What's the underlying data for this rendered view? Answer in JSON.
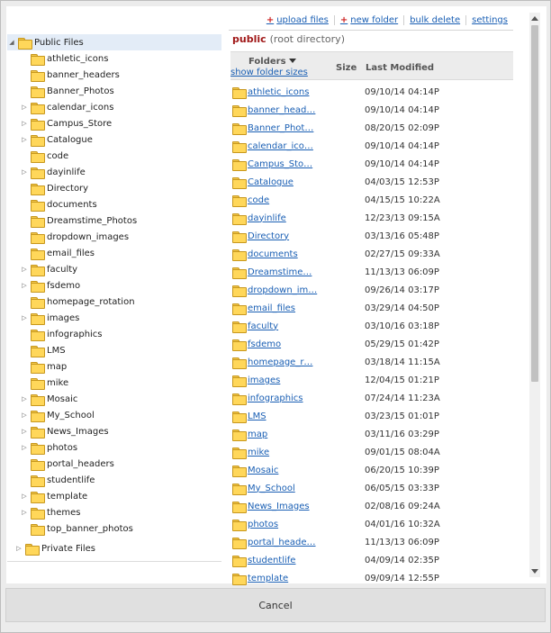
{
  "toolbar": {
    "upload_label": "upload files",
    "new_folder_label": "new folder",
    "bulk_delete_label": "bulk delete",
    "settings_label": "settings"
  },
  "path": {
    "root_name": "public",
    "root_desc": "(root directory)"
  },
  "list_header": {
    "folders_label": "Folders",
    "new_folder_sizes": "show folder sizes",
    "size_label": "Size",
    "modified_label": "Last Modified"
  },
  "tree": {
    "public_label": "Public Files",
    "private_label": "Private Files",
    "items": [
      {
        "label": "athletic_icons",
        "expandable": false
      },
      {
        "label": "banner_headers",
        "expandable": false
      },
      {
        "label": "Banner_Photos",
        "expandable": false
      },
      {
        "label": "calendar_icons",
        "expandable": true
      },
      {
        "label": "Campus_Store",
        "expandable": true
      },
      {
        "label": "Catalogue",
        "expandable": true
      },
      {
        "label": "code",
        "expandable": false
      },
      {
        "label": "dayinlife",
        "expandable": true
      },
      {
        "label": "Directory",
        "expandable": false
      },
      {
        "label": "documents",
        "expandable": false
      },
      {
        "label": "Dreamstime_Photos",
        "expandable": false
      },
      {
        "label": "dropdown_images",
        "expandable": false
      },
      {
        "label": "email_files",
        "expandable": false
      },
      {
        "label": "faculty",
        "expandable": true
      },
      {
        "label": "fsdemo",
        "expandable": true
      },
      {
        "label": "homepage_rotation",
        "expandable": false
      },
      {
        "label": "images",
        "expandable": true
      },
      {
        "label": "infographics",
        "expandable": false
      },
      {
        "label": "LMS",
        "expandable": false
      },
      {
        "label": "map",
        "expandable": false
      },
      {
        "label": "mike",
        "expandable": false
      },
      {
        "label": "Mosaic",
        "expandable": true
      },
      {
        "label": "My_School",
        "expandable": true
      },
      {
        "label": "News_Images",
        "expandable": true
      },
      {
        "label": "photos",
        "expandable": true
      },
      {
        "label": "portal_headers",
        "expandable": false
      },
      {
        "label": "studentlife",
        "expandable": false
      },
      {
        "label": "template",
        "expandable": true
      },
      {
        "label": "themes",
        "expandable": true
      },
      {
        "label": "top_banner_photos",
        "expandable": false
      }
    ]
  },
  "folders": [
    {
      "name": "athletic_icons",
      "modified": "09/10/14 04:14P"
    },
    {
      "name": "banner_head…",
      "modified": "09/10/14 04:14P"
    },
    {
      "name": "Banner_Phot…",
      "modified": "08/20/15 02:09P"
    },
    {
      "name": "calendar_ico…",
      "modified": "09/10/14 04:14P"
    },
    {
      "name": "Campus_Sto…",
      "modified": "09/10/14 04:14P"
    },
    {
      "name": "Catalogue",
      "modified": "04/03/15 12:53P"
    },
    {
      "name": "code",
      "modified": "04/15/15 10:22A"
    },
    {
      "name": "dayinlife",
      "modified": "12/23/13 09:15A"
    },
    {
      "name": "Directory",
      "modified": "03/13/16 05:48P"
    },
    {
      "name": "documents",
      "modified": "02/27/15 09:33A"
    },
    {
      "name": "Dreamstime…",
      "modified": "11/13/13 06:09P"
    },
    {
      "name": "dropdown_im…",
      "modified": "09/26/14 03:17P"
    },
    {
      "name": "email_files",
      "modified": "03/29/14 04:50P"
    },
    {
      "name": "faculty",
      "modified": "03/10/16 03:18P"
    },
    {
      "name": "fsdemo",
      "modified": "05/29/15 01:42P"
    },
    {
      "name": "homepage_r…",
      "modified": "03/18/14 11:15A"
    },
    {
      "name": "images",
      "modified": "12/04/15 01:21P"
    },
    {
      "name": "infographics",
      "modified": "07/24/14 11:23A"
    },
    {
      "name": "LMS",
      "modified": "03/23/15 01:01P"
    },
    {
      "name": "map",
      "modified": "03/11/16 03:29P"
    },
    {
      "name": "mike",
      "modified": "09/01/15 08:04A"
    },
    {
      "name": "Mosaic",
      "modified": "06/20/15 10:39P"
    },
    {
      "name": "My_School",
      "modified": "06/05/15 03:33P"
    },
    {
      "name": "News_Images",
      "modified": "02/08/16 09:24A"
    },
    {
      "name": "photos",
      "modified": "04/01/16 10:32A"
    },
    {
      "name": "portal_heade…",
      "modified": "11/13/13 06:09P"
    },
    {
      "name": "studentlife",
      "modified": "04/09/14 02:35P"
    },
    {
      "name": "template",
      "modified": "09/09/14 12:55P"
    }
  ],
  "footer": {
    "cancel_label": "Cancel"
  },
  "icons": {
    "folder": "folder-icon",
    "plus": "plus-icon",
    "sort": "sort-down-icon",
    "expand": "triangle-right-icon",
    "collapse": "triangle-down-icon"
  }
}
